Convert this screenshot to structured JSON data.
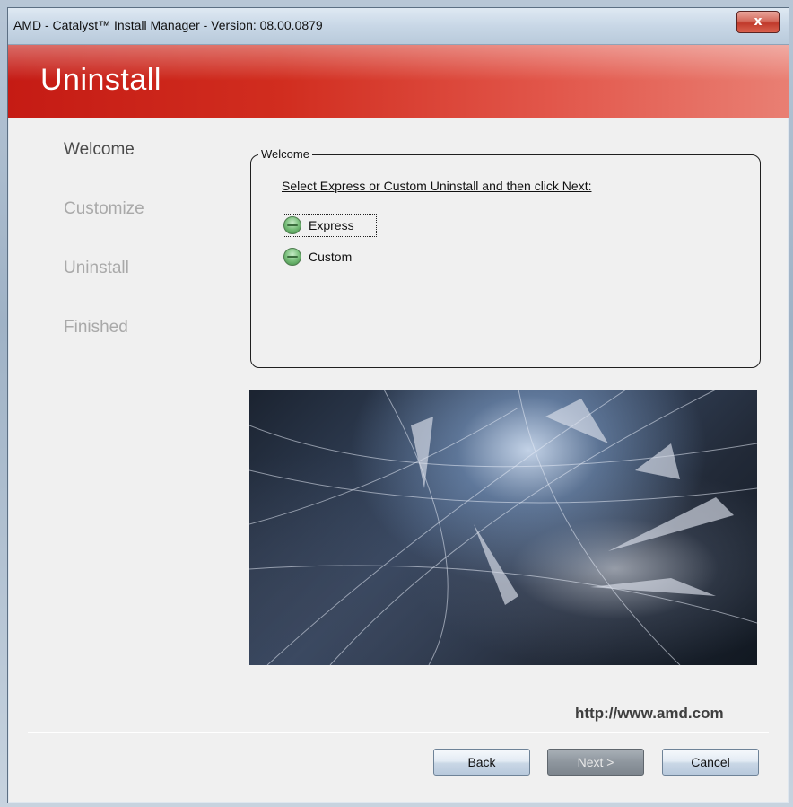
{
  "window": {
    "title": "AMD - Catalyst™ Install Manager - Version: 08.00.0879",
    "close_glyph": "x"
  },
  "banner": {
    "title": "Uninstall"
  },
  "steps": [
    {
      "label": "Welcome",
      "active": true
    },
    {
      "label": "Customize",
      "active": false
    },
    {
      "label": "Uninstall",
      "active": false
    },
    {
      "label": "Finished",
      "active": false
    }
  ],
  "welcome_group": {
    "legend": "Welcome",
    "instruction": "Select Express or Custom Uninstall and then click Next:",
    "options": [
      {
        "label": "Express",
        "focused": true
      },
      {
        "label": "Custom",
        "focused": false
      }
    ]
  },
  "footer": {
    "url": "http://www.amd.com",
    "back_label": "Back",
    "next_label_first": "N",
    "next_label_rest": "ext >",
    "cancel_label": "Cancel"
  },
  "colors": {
    "banner_start": "#c51b14",
    "banner_end": "#e97f73",
    "radio_green": "#78be7a"
  }
}
